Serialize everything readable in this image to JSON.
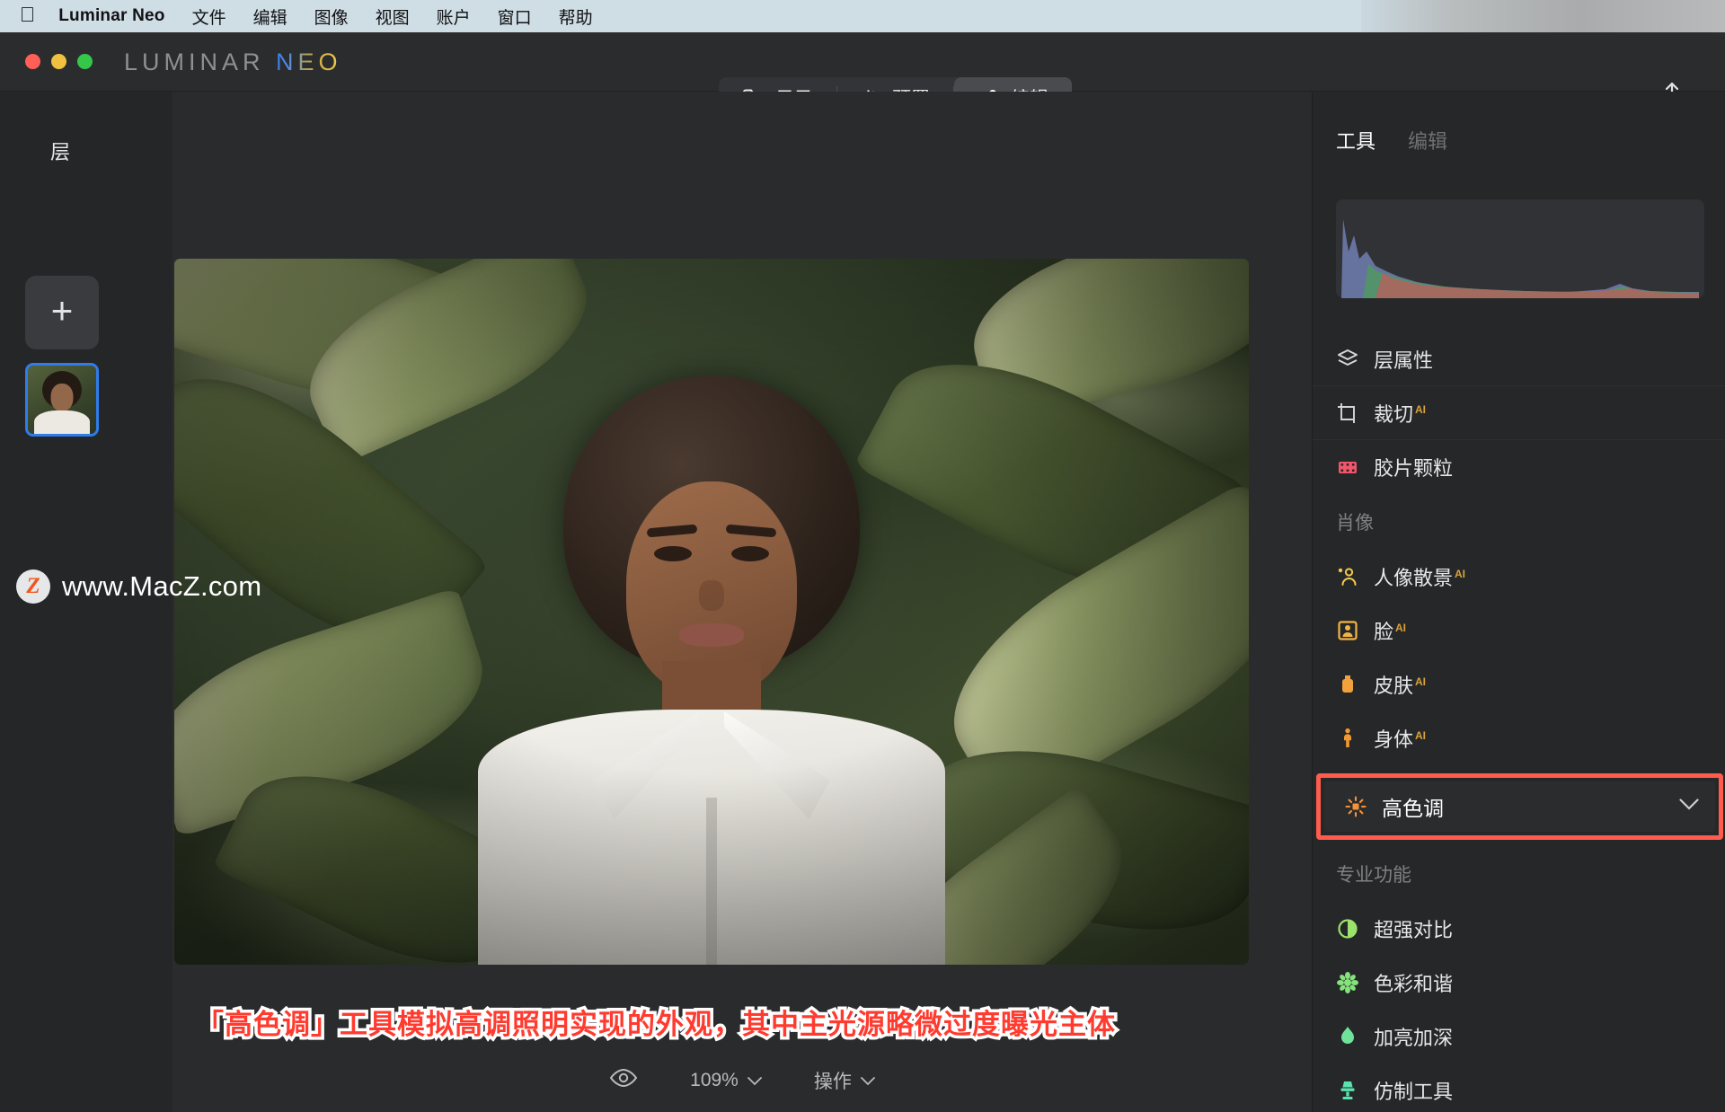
{
  "menubar": {
    "apple_icon": "apple-logo",
    "app_name": "Luminar Neo",
    "items": [
      "文件",
      "编辑",
      "图像",
      "视图",
      "账户",
      "窗口",
      "帮助"
    ]
  },
  "titlebar": {
    "logo_primary": "LUMINAR",
    "logo_accent": "NEO",
    "modes": [
      {
        "label": "目录",
        "icon": "folder-icon",
        "active": false
      },
      {
        "label": "预置",
        "icon": "sparkle-icon",
        "active": false
      },
      {
        "label": "编辑",
        "icon": "sliders-icon",
        "active": true
      }
    ],
    "share_icon": "share-icon"
  },
  "left_panel": {
    "title": "层",
    "add_layer_icon": "plus-icon",
    "layer_thumbnail_name": "portrait-layer"
  },
  "watermark": {
    "badge": "Z",
    "text": "www.MacZ.com"
  },
  "status_bar": {
    "eye_icon": "eye-icon",
    "zoom_level": "109%",
    "zoom_chevron": "chevron-down-icon",
    "actions_label": "操作",
    "actions_chevron": "chevron-down-icon"
  },
  "caption": {
    "text": "「高色调」工具模拟高调照明实现的外观，其中主光源略微过度曝光主体",
    "color": "#ff3b30",
    "outline_color": "#ffffff"
  },
  "right_panel": {
    "tabs": [
      {
        "label": "工具",
        "active": true
      },
      {
        "label": "编辑",
        "active": false
      }
    ],
    "histogram": {
      "name": "rgb-histogram"
    },
    "top_tools": [
      {
        "label": "层属性",
        "icon": "layers-icon",
        "icon_color": "#d6d7da",
        "ai": false
      },
      {
        "label": "裁切",
        "icon": "crop-icon",
        "icon_color": "#d6d7da",
        "ai": true
      },
      {
        "label": "胶片颗粒",
        "icon": "film-icon",
        "icon_color": "#f2566b",
        "ai": false
      }
    ],
    "portrait_group": {
      "header": "肖像",
      "tools": [
        {
          "label": "人像散景",
          "icon": "portrait-bokeh-icon",
          "icon_color": "#f2c94c",
          "ai": true
        },
        {
          "label": "脸",
          "icon": "face-icon",
          "icon_color": "#f2b544",
          "ai": true
        },
        {
          "label": "皮肤",
          "icon": "skin-icon",
          "icon_color": "#f0a33c",
          "ai": true
        },
        {
          "label": "身体",
          "icon": "body-icon",
          "icon_color": "#f09a33",
          "ai": true
        }
      ]
    },
    "selected_tool": {
      "label": "高色调",
      "icon": "high-key-sun-icon",
      "icon_color": "#f4923a",
      "chevron": "chevron-down-icon",
      "highlight_color": "#ff5c4d"
    },
    "pro_group": {
      "header": "专业功能",
      "tools": [
        {
          "label": "超强对比",
          "icon": "contrast-icon",
          "icon_color": "#9be36a",
          "ai": false
        },
        {
          "label": "色彩和谐",
          "icon": "color-harmony-icon",
          "icon_color": "#84e37a",
          "ai": false
        },
        {
          "label": "加亮加深",
          "icon": "dodge-burn-icon",
          "icon_color": "#6fe39a",
          "ai": false
        },
        {
          "label": "仿制工具",
          "icon": "clone-stamp-icon",
          "icon_color": "#5ae3b0",
          "ai": false
        }
      ]
    }
  }
}
